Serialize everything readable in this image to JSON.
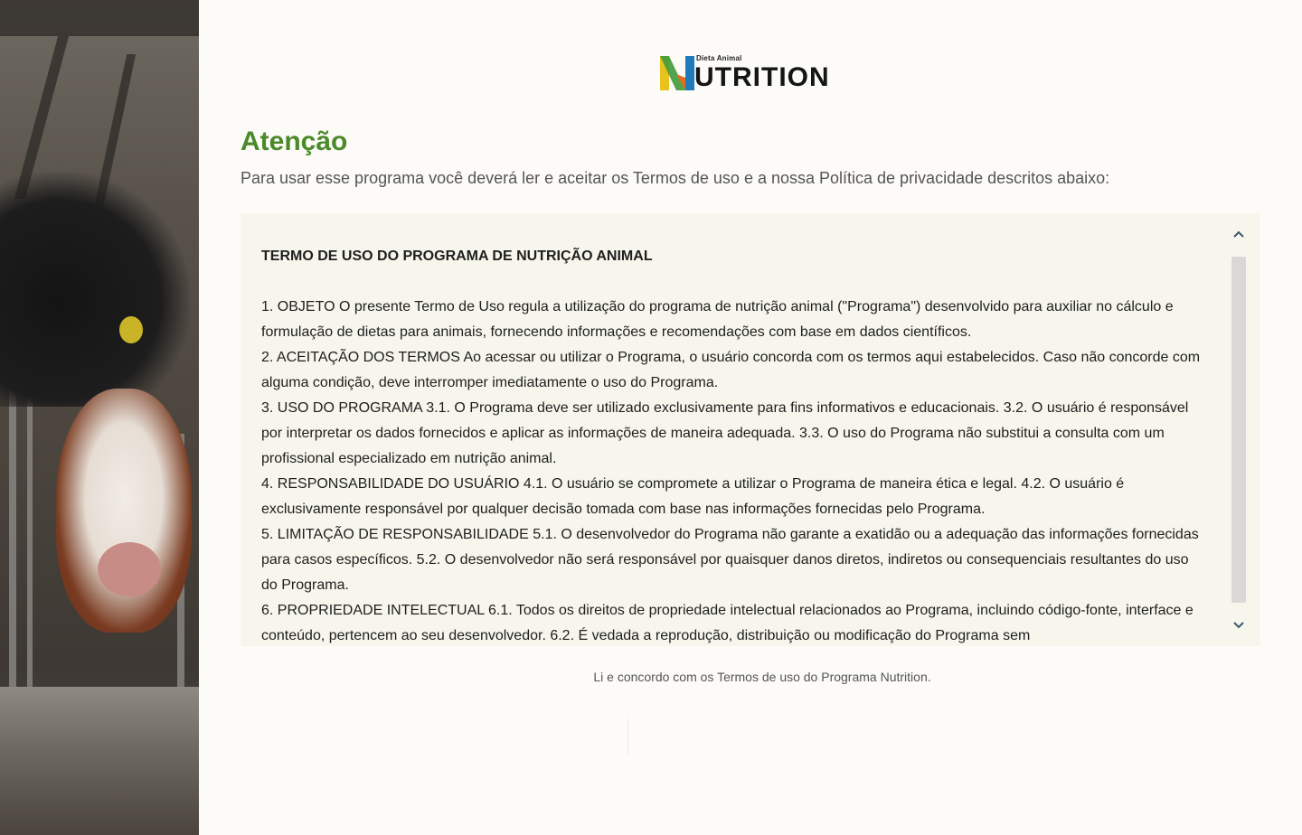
{
  "logo": {
    "small_text": "Dieta Animal",
    "brand_rest": "UTRITION",
    "colors": [
      "#e9c31d",
      "#3f9b3c",
      "#1e7ab8",
      "#e36c1f"
    ]
  },
  "header": {
    "title": "Atenção",
    "subtitle": "Para usar esse programa você deverá ler e aceitar os Termos de uso e a nossa Política de privacidade descritos abaixo:"
  },
  "terms": {
    "heading": "TERMO DE USO DO PROGRAMA DE NUTRIÇÃO ANIMAL",
    "clauses": [
      "1. OBJETO O presente Termo de Uso regula a utilização do programa de nutrição animal (\"Programa\") desenvolvido para auxiliar no cálculo e formulação de dietas para animais, fornecendo informações e recomendações com base em dados científicos.",
      "2. ACEITAÇÃO DOS TERMOS Ao acessar ou utilizar o Programa, o usuário concorda com os termos aqui estabelecidos. Caso não concorde com alguma condição, deve interromper imediatamente o uso do Programa.",
      "3. USO DO PROGRAMA 3.1. O Programa deve ser utilizado exclusivamente para fins informativos e educacionais. 3.2. O usuário é responsável por interpretar os dados fornecidos e aplicar as informações de maneira adequada. 3.3. O uso do Programa não substitui a consulta com um profissional especializado em nutrição animal.",
      "4. RESPONSABILIDADE DO USUÁRIO 4.1. O usuário se compromete a utilizar o Programa de maneira ética e legal. 4.2. O usuário é exclusivamente responsável por qualquer decisão tomada com base nas informações fornecidas pelo Programa.",
      "5. LIMITAÇÃO DE RESPONSABILIDADE 5.1. O desenvolvedor do Programa não garante a exatidão ou a adequação das informações fornecidas para casos específicos. 5.2. O desenvolvedor não será responsável por quaisquer danos diretos, indiretos ou consequenciais resultantes do uso do Programa.",
      "6. PROPRIEDADE INTELECTUAL 6.1. Todos os direitos de propriedade intelectual relacionados ao Programa, incluindo código-fonte, interface e conteúdo, pertencem ao seu desenvolvedor. 6.2. É vedada a reprodução, distribuição ou modificação do Programa sem"
    ],
    "scroll_up_icon": "chevron-up-icon",
    "scroll_down_icon": "chevron-down-icon"
  },
  "footer": {
    "agree_text": "Li e concordo com os Termos de uso do Programa Nutrition."
  },
  "colors": {
    "accent_green": "#4a8a2a",
    "terms_background": "#f7f6ec",
    "page_background": "#fcfbf7"
  }
}
